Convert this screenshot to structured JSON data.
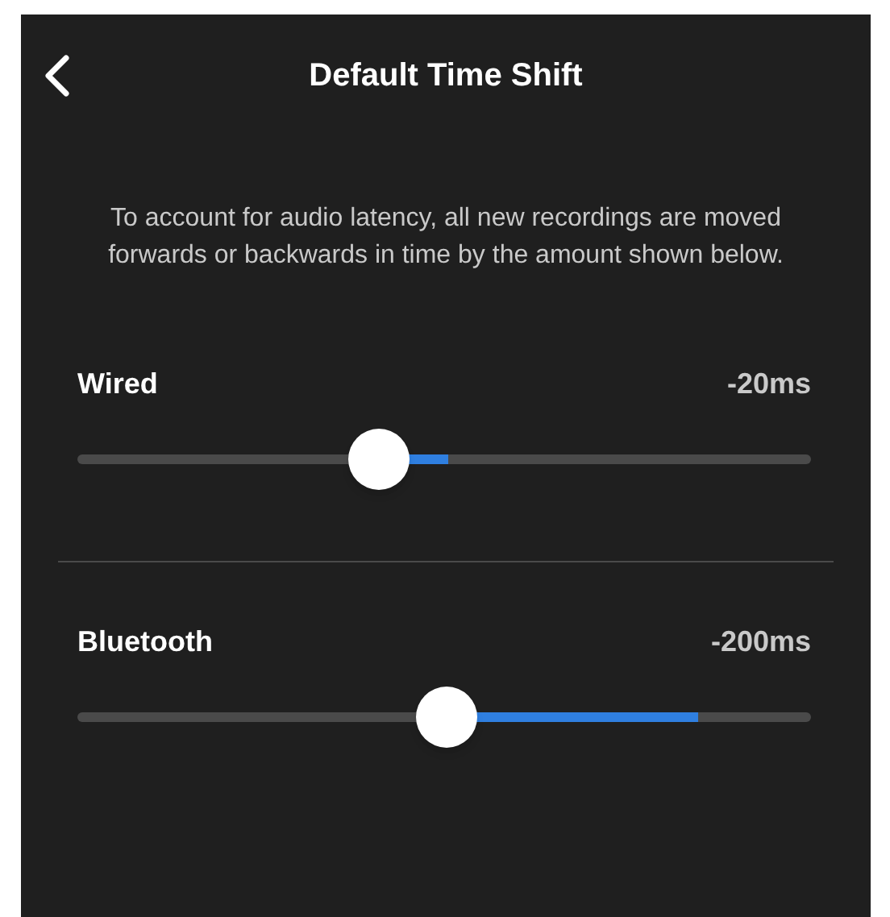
{
  "header": {
    "title": "Default Time Shift"
  },
  "description": "To account for audio latency, all new recordings are moved forwards or backwards in time by the amount shown below.",
  "sliders": [
    {
      "label": "Wired",
      "reading": "-20ms",
      "level": 0.41,
      "fill": {
        "level": 0.505
      }
    },
    {
      "label": "Bluetooth",
      "reading": "-200ms",
      "level": 0.503,
      "fill": {
        "level": 0.846
      }
    }
  ]
}
